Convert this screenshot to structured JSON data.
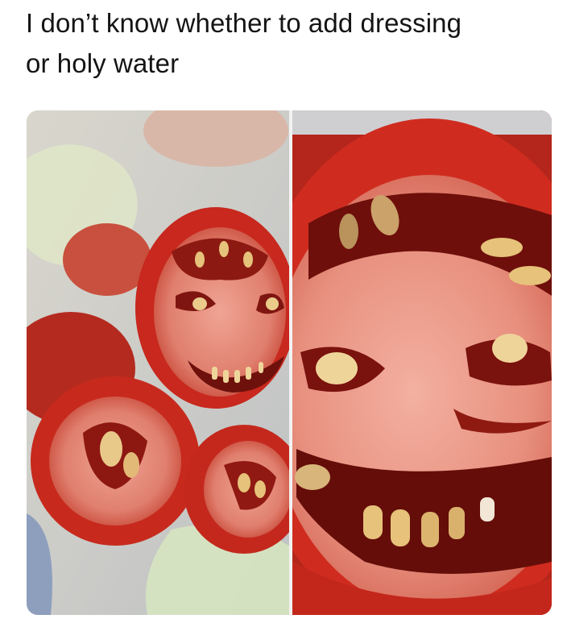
{
  "post": {
    "caption_line_1": "I don’t know whether to add dressing",
    "caption_line_2": "or holy water"
  },
  "image": {
    "left_panel": "zoomed-out-tomato-slices",
    "right_panel": "zoomed-in-tomato-face",
    "colors": {
      "tomato_red": "#c8281d",
      "tomato_flesh": "#e98a7a",
      "seed_yellow": "#e6c27a",
      "napkin_white": "#e4e2dc",
      "lettuce_green": "#d9e6c6"
    }
  }
}
